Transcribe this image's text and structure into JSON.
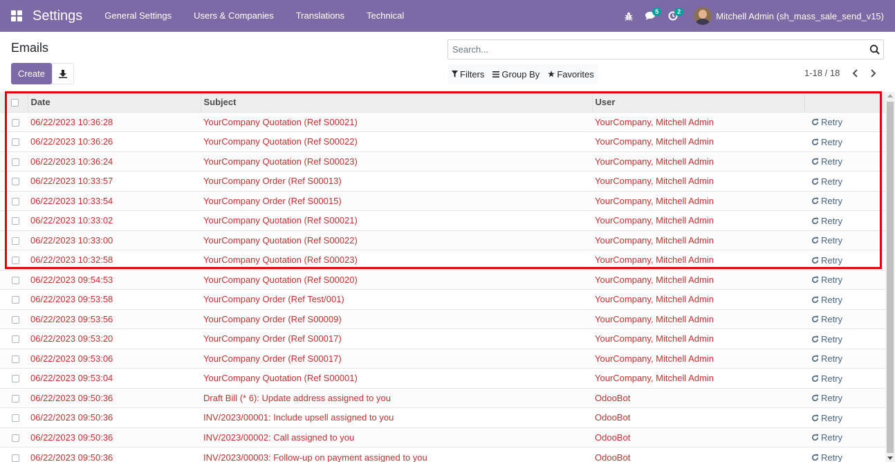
{
  "app": {
    "title": "Settings",
    "menu": [
      "General Settings",
      "Users & Companies",
      "Translations",
      "Technical"
    ],
    "messages_badge": "5",
    "activities_badge": "2",
    "user_name": "Mitchell Admin (sh_mass_sale_send_v15)"
  },
  "control_panel": {
    "breadcrumb": "Emails",
    "create_label": "Create",
    "search_placeholder": "Search...",
    "filters_label": "Filters",
    "group_by_label": "Group By",
    "favorites_label": "Favorites",
    "pager": "1-18 / 18"
  },
  "table": {
    "columns": [
      "Date",
      "Subject",
      "User"
    ],
    "retry_label": "Retry",
    "rows": [
      {
        "date": "06/22/2023 10:36:28",
        "subject": "YourCompany Quotation (Ref S00021)",
        "user": "YourCompany, Mitchell Admin"
      },
      {
        "date": "06/22/2023 10:36:26",
        "subject": "YourCompany Quotation (Ref S00022)",
        "user": "YourCompany, Mitchell Admin"
      },
      {
        "date": "06/22/2023 10:36:24",
        "subject": "YourCompany Quotation (Ref S00023)",
        "user": "YourCompany, Mitchell Admin"
      },
      {
        "date": "06/22/2023 10:33:57",
        "subject": "YourCompany Order (Ref S00013)",
        "user": "YourCompany, Mitchell Admin"
      },
      {
        "date": "06/22/2023 10:33:54",
        "subject": "YourCompany Order (Ref S00015)",
        "user": "YourCompany, Mitchell Admin"
      },
      {
        "date": "06/22/2023 10:33:02",
        "subject": "YourCompany Quotation (Ref S00021)",
        "user": "YourCompany, Mitchell Admin"
      },
      {
        "date": "06/22/2023 10:33:00",
        "subject": "YourCompany Quotation (Ref S00022)",
        "user": "YourCompany, Mitchell Admin"
      },
      {
        "date": "06/22/2023 10:32:58",
        "subject": "YourCompany Quotation (Ref S00023)",
        "user": "YourCompany, Mitchell Admin"
      },
      {
        "date": "06/22/2023 09:54:53",
        "subject": "YourCompany Quotation (Ref S00020)",
        "user": "YourCompany, Mitchell Admin"
      },
      {
        "date": "06/22/2023 09:53:58",
        "subject": "YourCompany Order (Ref Test/001)",
        "user": "YourCompany, Mitchell Admin"
      },
      {
        "date": "06/22/2023 09:53:56",
        "subject": "YourCompany Order (Ref S00009)",
        "user": "YourCompany, Mitchell Admin"
      },
      {
        "date": "06/22/2023 09:53:20",
        "subject": "YourCompany Order (Ref S00017)",
        "user": "YourCompany, Mitchell Admin"
      },
      {
        "date": "06/22/2023 09:53:06",
        "subject": "YourCompany Order (Ref S00017)",
        "user": "YourCompany, Mitchell Admin"
      },
      {
        "date": "06/22/2023 09:53:04",
        "subject": "YourCompany Quotation (Ref S00001)",
        "user": "YourCompany, Mitchell Admin"
      },
      {
        "date": "06/22/2023 09:50:36",
        "subject": "Draft Bill (* 6): Update address assigned to you",
        "user": "OdooBot"
      },
      {
        "date": "06/22/2023 09:50:36",
        "subject": "INV/2023/00001: Include upsell assigned to you",
        "user": "OdooBot"
      },
      {
        "date": "06/22/2023 09:50:36",
        "subject": "INV/2023/00002: Call assigned to you",
        "user": "OdooBot"
      },
      {
        "date": "06/22/2023 09:50:36",
        "subject": "INV/2023/00003: Follow-up on payment assigned to you",
        "user": "OdooBot"
      }
    ]
  },
  "colors": {
    "navbar": "#7c6aa6",
    "failed_text": "#c62f2f",
    "highlight_border": "#e3000f",
    "badge": "#00a09d"
  }
}
